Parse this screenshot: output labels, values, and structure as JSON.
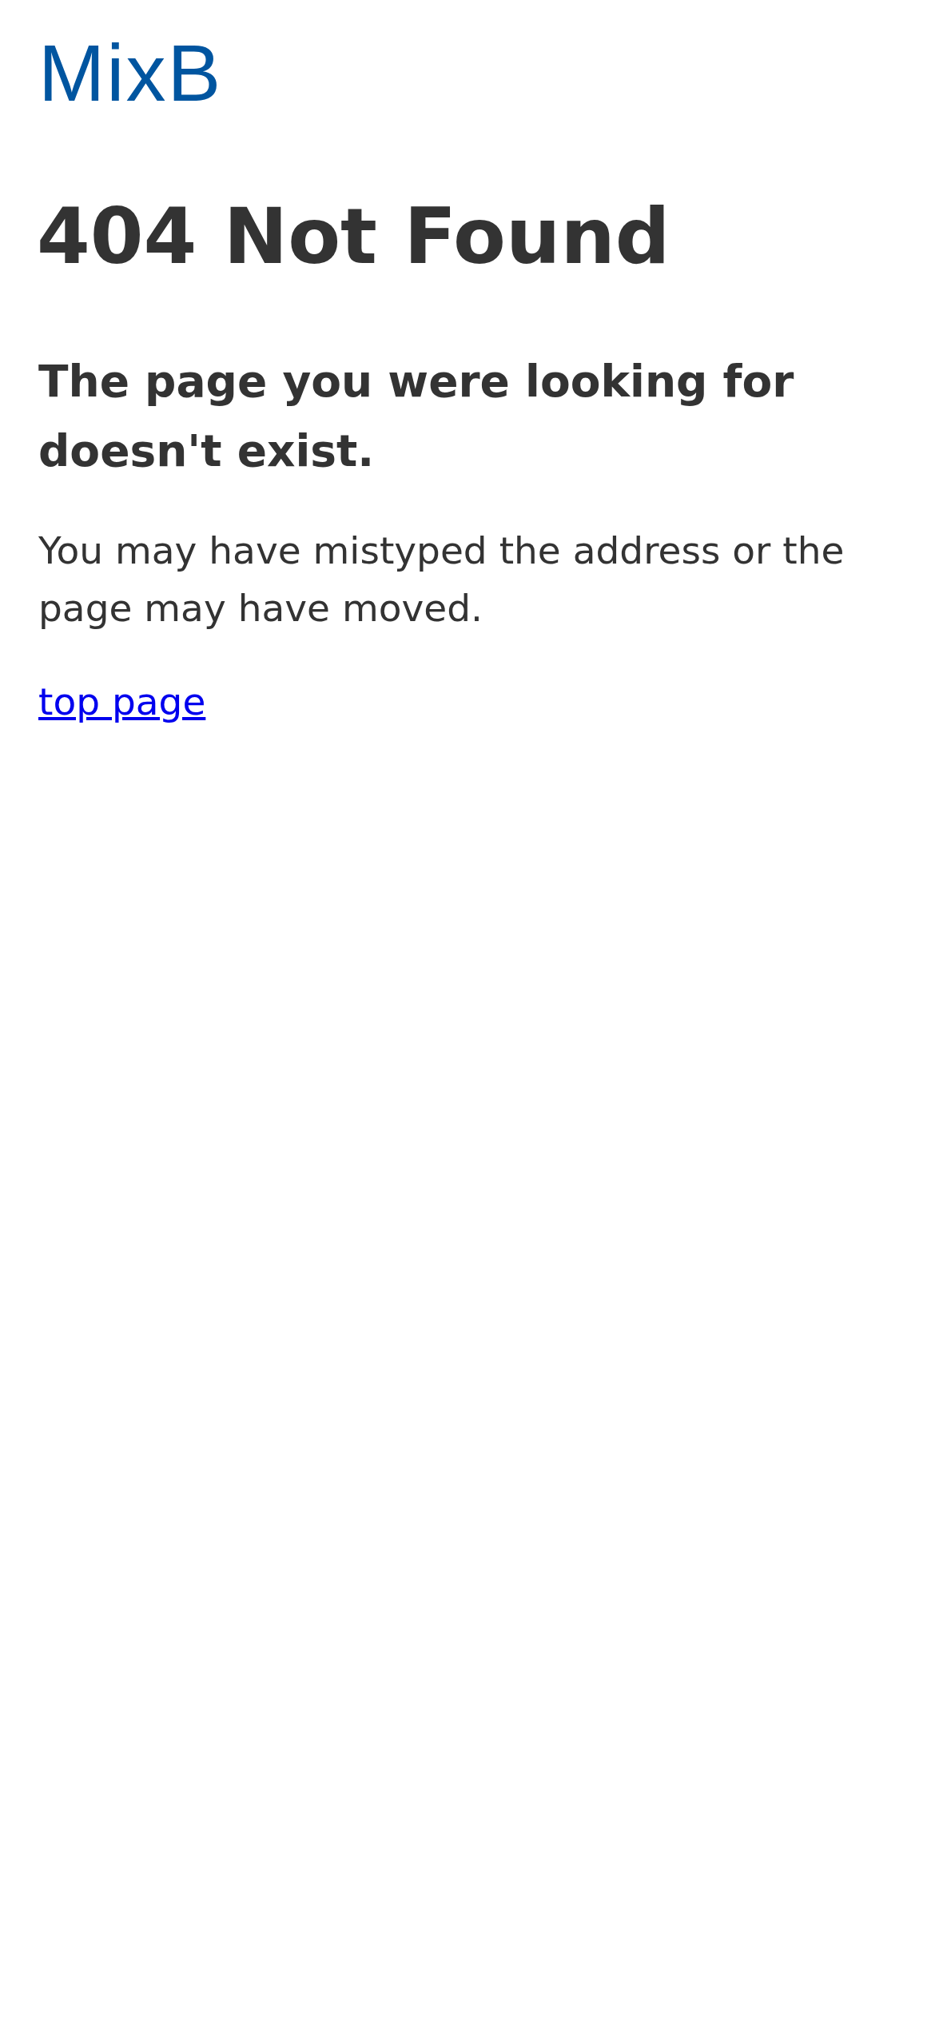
{
  "logo": "MixB",
  "title": "404 Not Found",
  "subtitle": "The page you were looking for doesn't exist.",
  "message": "You may have mistyped the address or the page may have moved.",
  "link": "top page"
}
